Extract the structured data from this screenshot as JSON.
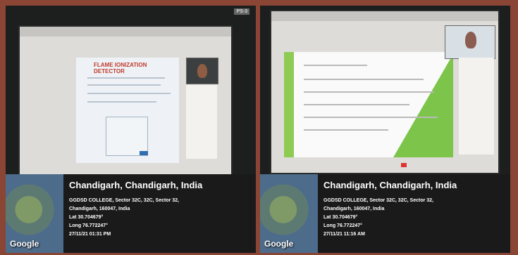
{
  "left": {
    "badge": "PS-3",
    "city": "Chandigarh, Chandigarh, India",
    "address_line_1": "GGDSD COLLEGE, Sector 32C, 32C, Sector 32,",
    "address_line_2": "Chandigarh, 160047, India",
    "lat": "Lat 30.704679°",
    "long": "Long 76.772247°",
    "datetime": "27/11/21 01:31 PM",
    "map_label": "Google",
    "slide_title": "FLAME IONIZATION DETECTOR"
  },
  "right": {
    "city": "Chandigarh, Chandigarh, India",
    "address_line_1": "GGDSD COLLEGE, Sector 32C, 32C, Sector 32,",
    "address_line_2": "Chandigarh, 160047, India",
    "lat": "Lat 30.704679°",
    "long": "Long 76.772247°",
    "datetime": "27/11/21 11:16 AM",
    "map_label": "Google"
  },
  "colors": {
    "frame": "#8a4535",
    "overlay": "#1a1a1a",
    "slide_green": "#7dc44a"
  }
}
